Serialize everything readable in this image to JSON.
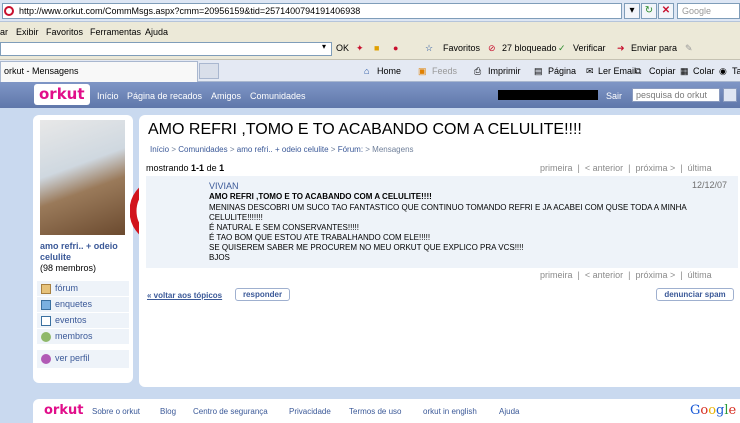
{
  "browser": {
    "url": "http://www.orkut.com/CommMsgs.aspx?cmm=20956159&tid=2571400794191406938",
    "search_placeholder": "Google",
    "menu": [
      "ar",
      "Exibir",
      "Favoritos",
      "Ferramentas",
      "Ajuda"
    ],
    "toolbar": {
      "ok": "OK",
      "favoritos": "Favoritos",
      "bloqueado": "27 bloqueado",
      "verificar": "Verificar",
      "enviar": "Enviar para"
    },
    "tab_title": "orkut - Mensagens",
    "commands": [
      "Home",
      "Feeds",
      "Imprimir",
      "Página",
      "Ler Email",
      "Copiar",
      "Colar",
      "Ta"
    ]
  },
  "header": {
    "logo": "orkut",
    "nav": [
      "Início",
      "Página de recados",
      "Amigos",
      "Comunidades"
    ],
    "sair": "Sair",
    "search_placeholder": "pesquisa do orkut"
  },
  "sidebar": {
    "community_name": "amo refri.. + odeio celulite",
    "members": "(98 membros)",
    "items": [
      "fórum",
      "enquetes",
      "eventos",
      "membros"
    ],
    "perfil": "ver perfil"
  },
  "main": {
    "title": "AMO REFRI ,TOMO E TO ACABANDO COM A CELULITE!!!!",
    "breadcrumb": [
      "Início",
      "Comunidades",
      "amo refri.. + odeio celulite",
      "Fórum:",
      "Mensagens"
    ],
    "mostrando_prefix": "mostrando",
    "mostrando_range": "1-1",
    "mostrando_mid": "de",
    "mostrando_total": "1",
    "pager": {
      "first": "primeira",
      "prev": "< anterior",
      "next": "próxima >",
      "last": "última"
    },
    "post": {
      "author": "VIVIAN",
      "date": "12/12/07",
      "subject": "AMO REFRI ,TOMO E TO ACABANDO COM A CELULITE!!!!",
      "body": "MENINAS DESCOBRI UM SUCO TAO FANTASTICO QUE CONTINUO TOMANDO REFRI E JA ACABEI COM QUSE TODA A MINHA CELULITE!!!!!!!\nÉ NATURAL E SEM CONSERVANTES!!!!!\nÉ TAO BOM QUE ESTOU ATE TRABALHANDO COM ELE!!!!!\nSE QUISEREM SABER ME PROCUREM NO MEU ORKUT QUE EXPLICO PRA VCS!!!!\nBJOS"
    },
    "back_link": "« voltar aos tópicos",
    "respond": "responder",
    "report_spam": "denunciar spam"
  },
  "footer": {
    "logo": "orkut",
    "links": [
      "Sobre o orkut",
      "Blog",
      "Centro de segurança",
      "Privacidade",
      "Termos de uso",
      "orkut in english",
      "Ajuda"
    ],
    "google": "Google"
  }
}
